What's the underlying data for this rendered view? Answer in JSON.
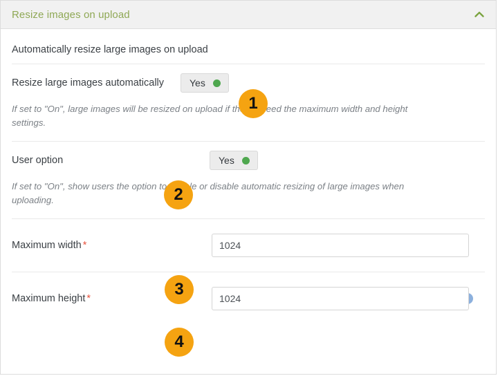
{
  "panel": {
    "header_title": "Resize images on upload",
    "collapse_icon": "chevron-up-icon",
    "section_heading": "Automatically resize large images on upload",
    "accent_green": "#8fa855",
    "badge_color": "#f5a311",
    "required_star_color": "#e8543f",
    "toggle_dot_color": "#4fa84f"
  },
  "fields": [
    {
      "label": "Resize large images automatically",
      "required": false,
      "required_mark": "",
      "control_type": "toggle",
      "value": "Yes",
      "badge": "1",
      "help": "If set to \"On\", large images will be resized on upload if they exceed the maximum width and height settings."
    },
    {
      "label": "User option",
      "required": false,
      "required_mark": "",
      "control_type": "toggle",
      "value": "Yes",
      "badge": "2",
      "help": "If set to \"On\", show users the option to enable or disable automatic resizing of large images when uploading."
    },
    {
      "label": "Maximum width",
      "required": true,
      "required_mark": "*",
      "control_type": "text",
      "value": "1024",
      "badge": "3",
      "help": ""
    },
    {
      "label": "Maximum height",
      "required": true,
      "required_mark": "*",
      "control_type": "text",
      "value": "1024",
      "badge": "4",
      "help": "",
      "info_icon": "info-icon"
    }
  ]
}
